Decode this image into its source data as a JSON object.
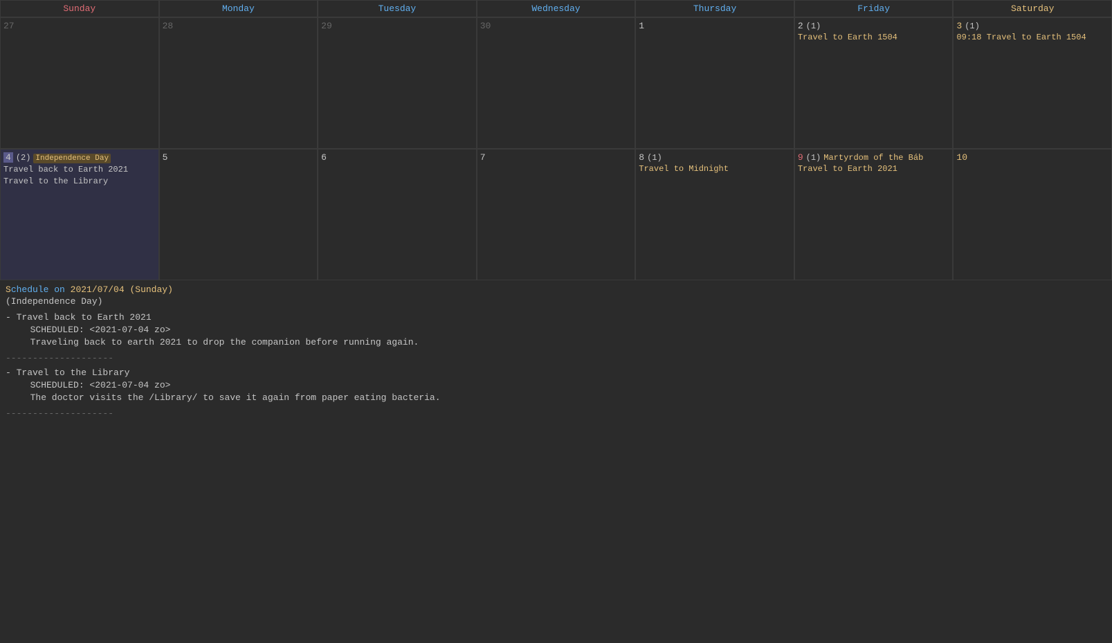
{
  "header": {
    "days": [
      {
        "label": "Sunday",
        "class": "day-sunday"
      },
      {
        "label": "Monday",
        "class": "day-monday"
      },
      {
        "label": "Tuesday",
        "class": "day-tuesday"
      },
      {
        "label": "Wednesday",
        "class": "day-wednesday"
      },
      {
        "label": "Thursday",
        "class": "day-thursday"
      },
      {
        "label": "Friday",
        "class": "day-friday"
      },
      {
        "label": "Saturday",
        "class": "day-saturday"
      }
    ]
  },
  "week1": [
    {
      "date": "27",
      "dateClass": "other-month",
      "events": []
    },
    {
      "date": "28",
      "dateClass": "other-month",
      "events": []
    },
    {
      "date": "29",
      "dateClass": "other-month",
      "events": []
    },
    {
      "date": "30",
      "dateClass": "other-month",
      "events": []
    },
    {
      "date": "1",
      "dateClass": "normal",
      "events": []
    },
    {
      "date": "2",
      "dateClass": "normal",
      "eventCount": "(1)",
      "events": [
        {
          "text": "Travel to Earth 1504",
          "class": "event-orange"
        }
      ]
    },
    {
      "date": "3",
      "dateClass": "saturday",
      "eventCount": "(1)",
      "events": [
        {
          "text": "09:18 Travel to Earth 1504",
          "class": "event-orange"
        }
      ]
    }
  ],
  "week2": [
    {
      "date": "4",
      "dateClass": "sunday-highlighted",
      "eventCount": "(2)",
      "holiday": "Independence Day",
      "events": [
        {
          "text": "Travel back to Earth 2021",
          "class": "event-text"
        },
        {
          "text": "Travel to the Library",
          "class": "event-text"
        }
      ]
    },
    {
      "date": "5",
      "dateClass": "normal",
      "events": []
    },
    {
      "date": "6",
      "dateClass": "normal",
      "events": []
    },
    {
      "date": "7",
      "dateClass": "normal",
      "events": []
    },
    {
      "date": "8",
      "dateClass": "normal",
      "eventCount": "(1)",
      "events": [
        {
          "text": "Travel to Midnight",
          "class": "event-orange"
        }
      ]
    },
    {
      "date": "9",
      "dateClass": "normal",
      "eventCount": "(1)",
      "holiday": "Martyrdom of the Báb",
      "events": [
        {
          "text": "Travel to Earth 2021",
          "class": "event-orange"
        }
      ]
    },
    {
      "date": "10",
      "dateClass": "saturday",
      "events": []
    }
  ],
  "schedule": {
    "title_date": "2021/07/04",
    "title_day": "Sunday",
    "subtitle": "(Independence Day)",
    "entries": [
      {
        "title": "- Travel back to Earth 2021",
        "scheduled": "SCHEDULED: <2021-07-04 zo>",
        "description": "Traveling back to earth 2021 to drop the companion before running again."
      },
      {
        "title": "- Travel to the Library",
        "scheduled": "SCHEDULED: <2021-07-04 zo>",
        "description": "The doctor visits the /Library/ to save it again from paper eating bacteria."
      }
    ],
    "separator": "--------------------"
  }
}
